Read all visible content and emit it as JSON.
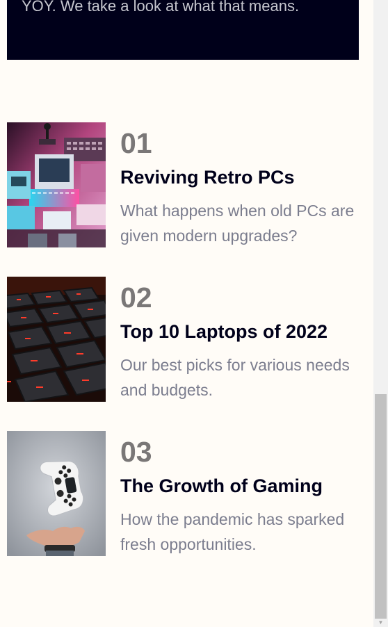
{
  "hero": {
    "text": "YOY. We take a look at what that means."
  },
  "articles": [
    {
      "number": "01",
      "title": "Reviving Retro PCs",
      "description": "What happens when old PCs are given modern upgrades?",
      "image_icon": "retro-pcs-image"
    },
    {
      "number": "02",
      "title": "Top 10 Laptops of 2022",
      "description": "Our best picks for various needs and budgets.",
      "image_icon": "laptop-keyboard-image"
    },
    {
      "number": "03",
      "title": "The Growth of Gaming",
      "description": "How the pandemic has sparked fresh opportunities.",
      "image_icon": "game-controller-image"
    }
  ],
  "colors": {
    "page_background": "#fffcf7",
    "hero_background": "#00001a",
    "number": "#7a7777",
    "title": "#00001a",
    "description": "#7b7d8e"
  }
}
